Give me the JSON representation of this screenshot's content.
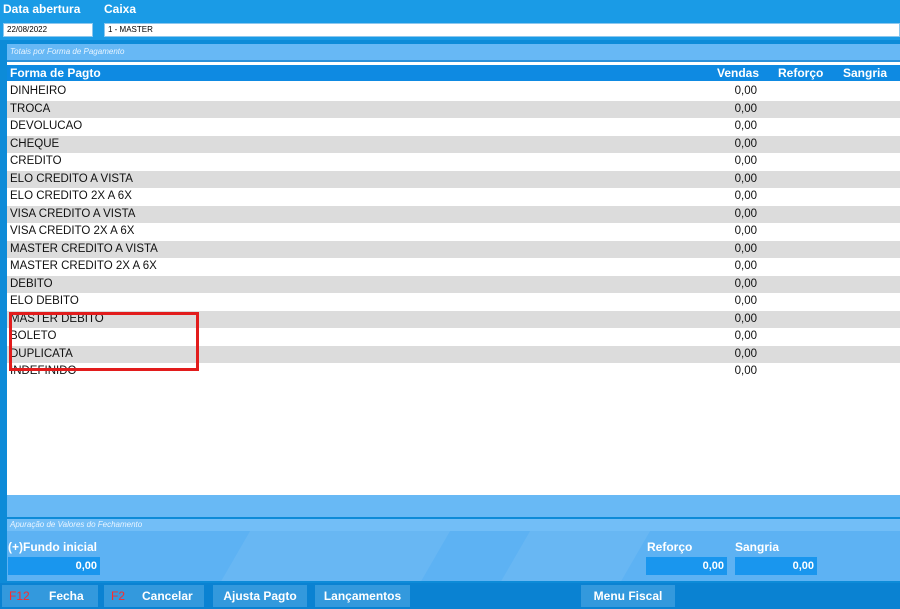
{
  "header": {
    "data_label": "Data abertura",
    "data_value": "22/08/2022",
    "caixa_label": "Caixa",
    "caixa_value": "1 - MASTER"
  },
  "totais": {
    "caption": "Totais por Forma de Pagamento",
    "columns": [
      "Forma de Pagto",
      "Vendas",
      "Reforço",
      "Sangria"
    ],
    "rows": [
      {
        "forma": "DINHEIRO",
        "vendas": "0,00"
      },
      {
        "forma": "TROCA",
        "vendas": "0,00"
      },
      {
        "forma": "DEVOLUCAO",
        "vendas": "0,00"
      },
      {
        "forma": "CHEQUE",
        "vendas": "0,00"
      },
      {
        "forma": "CREDITO",
        "vendas": "0,00"
      },
      {
        "forma": "ELO CREDITO A VISTA",
        "vendas": "0,00"
      },
      {
        "forma": "ELO CREDITO 2X A 6X",
        "vendas": "0,00"
      },
      {
        "forma": "VISA CREDITO A VISTA",
        "vendas": "0,00"
      },
      {
        "forma": "VISA CREDITO 2X A 6X",
        "vendas": "0,00"
      },
      {
        "forma": "MASTER CREDITO A VISTA",
        "vendas": "0,00"
      },
      {
        "forma": "MASTER CREDITO 2X A 6X",
        "vendas": "0,00"
      },
      {
        "forma": "DEBITO",
        "vendas": "0,00"
      },
      {
        "forma": "ELO DEBITO",
        "vendas": "0,00"
      },
      {
        "forma": "MASTER DEBITO",
        "vendas": "0,00"
      },
      {
        "forma": "BOLETO",
        "vendas": "0,00"
      },
      {
        "forma": "DUPLICATA",
        "vendas": "0,00"
      },
      {
        "forma": "INDEFINIDO",
        "vendas": "0,00"
      }
    ],
    "highlight_color": "#e21c1c"
  },
  "apuracao": {
    "caption": "Apuração de Valores do Fechamento",
    "fundo_label": "(+)Fundo inicial",
    "fundo_value": "0,00",
    "reforco_label": "Reforço",
    "reforco_value": "0,00",
    "sangria_label": "Sangria",
    "sangria_value": "0,00"
  },
  "buttons": {
    "fecha_key": "F12",
    "fecha_label": "Fecha",
    "cancelar_key": "F2",
    "cancelar_label": "Cancelar",
    "ajusta_label": "Ajusta Pagto",
    "lancamentos_label": "Lançamentos",
    "menu_fiscal_label": "Menu Fiscal"
  }
}
